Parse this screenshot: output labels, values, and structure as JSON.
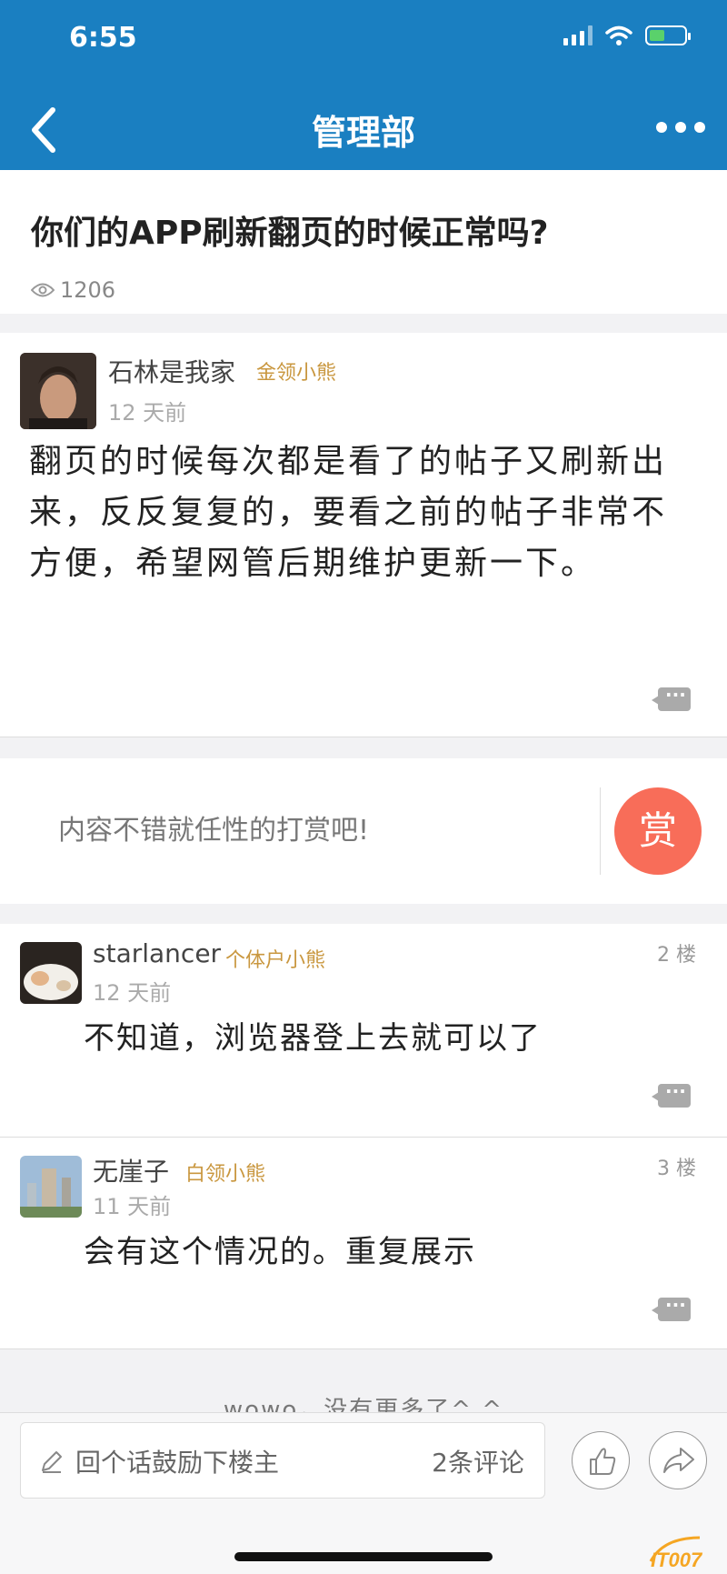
{
  "status_bar": {
    "time": "6:55"
  },
  "nav": {
    "title": "管理部"
  },
  "post": {
    "title": "你们的APP刷新翻页的时候正常吗?",
    "views": "1206"
  },
  "op": {
    "username": "石林是我家",
    "badge": "金领小熊",
    "time": "12 天前",
    "content": "翻页的时候每次都是看了的帖子又刷新出来，反反复复的，要看之前的帖子非常不方便，希望网管后期维护更新一下。"
  },
  "reward": {
    "prompt": "内容不错就任性的打赏吧!",
    "button": "赏"
  },
  "replies": [
    {
      "username": "starlancer",
      "badge": "个体户小熊",
      "time": "12 天前",
      "floor": "2 楼",
      "content": "不知道，浏览器登上去就可以了"
    },
    {
      "username": "无崖子",
      "badge": "白领小熊",
      "time": "11 天前",
      "floor": "3 楼",
      "content": "会有这个情况的。重复展示"
    }
  ],
  "end_text": "wowo，没有更多了^.^",
  "bottom": {
    "placeholder": "回个话鼓励下楼主",
    "comment_count": "2条评论"
  },
  "watermark": "IT007",
  "colors": {
    "header": "#1a7fc1",
    "reward": "#f86d59",
    "badge": "#c9973f"
  }
}
